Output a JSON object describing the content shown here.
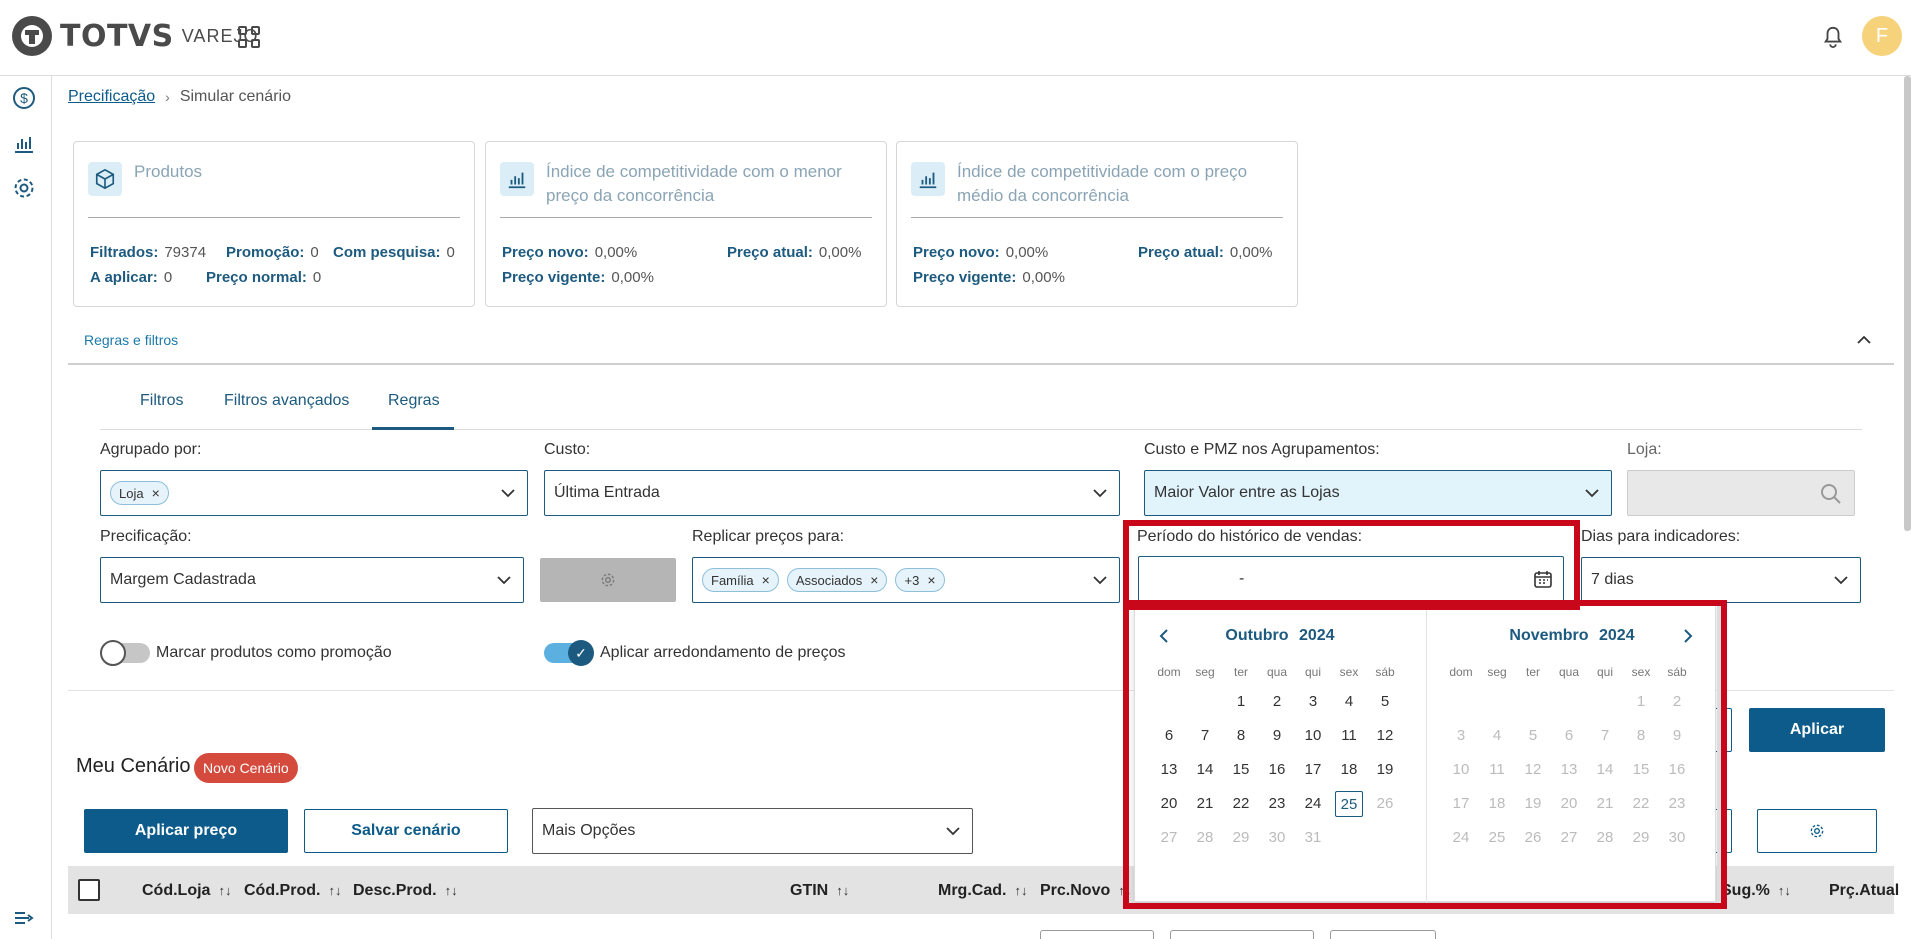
{
  "header": {
    "brand": "TOTVS",
    "product": "VAREJO",
    "avatar_initial": "F"
  },
  "breadcrumb": {
    "link": "Precificação",
    "current": "Simular cenário"
  },
  "cards": {
    "produtos": {
      "title": "Produtos",
      "filtrados_label": "Filtrados:",
      "filtrados_value": "79374",
      "promocao_label": "Promoção:",
      "promocao_value": "0",
      "pesquisa_label": "Com pesquisa:",
      "pesquisa_value": "0",
      "aplicar_label": "A aplicar:",
      "aplicar_value": "0",
      "normal_label": "Preço normal:",
      "normal_value": "0"
    },
    "menor": {
      "title": "Índice de competitividade com o menor preço da concorrência",
      "novo_label": "Preço novo:",
      "novo_value": "0,00%",
      "atual_label": "Preço atual:",
      "atual_value": "0,00%",
      "vigente_label": "Preço vigente:",
      "vigente_value": "0,00%"
    },
    "medio": {
      "title": "Índice de competitividade com o preço médio da concorrência",
      "novo_label": "Preço novo:",
      "novo_value": "0,00%",
      "atual_label": "Preço atual:",
      "atual_value": "0,00%",
      "vigente_label": "Preço vigente:",
      "vigente_value": "0,00%"
    }
  },
  "section": {
    "title": "Regras e filtros"
  },
  "tabs": [
    {
      "label": "Filtros"
    },
    {
      "label": "Filtros avançados"
    },
    {
      "label": "Regras"
    }
  ],
  "form": {
    "agrupado_label": "Agrupado por:",
    "agrupado_tag": "Loja",
    "custo_label": "Custo:",
    "custo_value": "Última Entrada",
    "pmz_label": "Custo e PMZ nos Agrupamentos:",
    "pmz_value": "Maior Valor entre as Lojas",
    "loja_label": "Loja:",
    "precificacao_label": "Precificação:",
    "precificacao_value": "Margem Cadastrada",
    "replicar_label": "Replicar preços para:",
    "replicar_tags": [
      "Família",
      "Associados",
      "+3"
    ],
    "periodo_label": "Período do histórico de vendas:",
    "periodo_value": "-",
    "dias_label": "Dias para indicadores:",
    "dias_value": "7 dias",
    "toggle_promocao": "Marcar produtos como promoção",
    "toggle_arredondamento": "Aplicar arredondamento de preços"
  },
  "scenario": {
    "title": "Meu Cenário",
    "badge": "Novo Cenário",
    "aplicar_preco": "Aplicar preço",
    "salvar": "Salvar cenário",
    "mais_opcoes": "Mais Opções",
    "aplicar": "Aplicar"
  },
  "table": {
    "columns": [
      "Cód.Loja",
      "Cód.Prod.",
      "Desc.Prod.",
      "GTIN",
      "Mrg.Cad.",
      "Prc.Novo",
      "Sug.%",
      "Prç.Atual"
    ]
  },
  "calendar": {
    "weekdays": [
      "dom",
      "seg",
      "ter",
      "qua",
      "qui",
      "sex",
      "sáb"
    ],
    "left_month": "Outubro",
    "left_year": "2024",
    "right_month": "Novembro",
    "right_year": "2024",
    "today": "25"
  },
  "colors": {
    "primary": "#0c5b8a",
    "highlight": "#c8071b",
    "badge": "#d44a3c"
  }
}
